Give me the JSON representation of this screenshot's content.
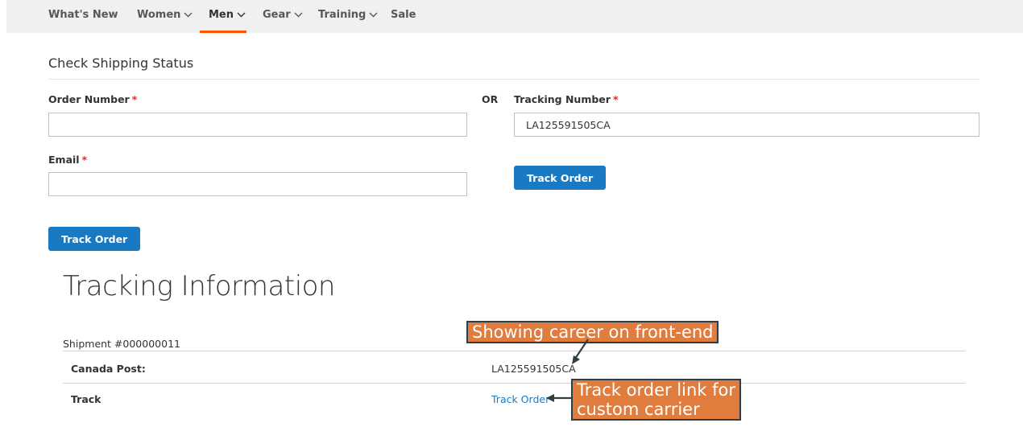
{
  "nav": {
    "items": [
      {
        "label": "What's New",
        "has_dropdown": false
      },
      {
        "label": "Women",
        "has_dropdown": true
      },
      {
        "label": "Men",
        "has_dropdown": true,
        "active": true
      },
      {
        "label": "Gear",
        "has_dropdown": true
      },
      {
        "label": "Training",
        "has_dropdown": true
      },
      {
        "label": "Sale",
        "has_dropdown": false
      }
    ],
    "active_color": "#ff5501"
  },
  "form": {
    "title": "Check Shipping Status",
    "order_number_label": "Order Number",
    "required_mark": "*",
    "order_number_value": "",
    "email_label": "Email",
    "email_value": "",
    "track_button_left": "Track Order",
    "or_label": "OR",
    "tracking_number_label": "Tracking Number",
    "tracking_number_value": "LA125591505CA",
    "track_button_right": "Track Order",
    "button_color": "#1979c3"
  },
  "tracking": {
    "title": "Tracking Information",
    "shipment_label": "Shipment #000000011",
    "rows": [
      {
        "key": "Canada Post:",
        "value": "LA125591505CA",
        "is_link": false
      },
      {
        "key": "Track",
        "value": "Track Order",
        "is_link": true
      }
    ]
  },
  "annotations": {
    "callout_1": "Showing career on front-end",
    "callout_2_line1": "Track order link for",
    "callout_2_line2": "custom carrier",
    "callout_color": "#e07c3e"
  }
}
